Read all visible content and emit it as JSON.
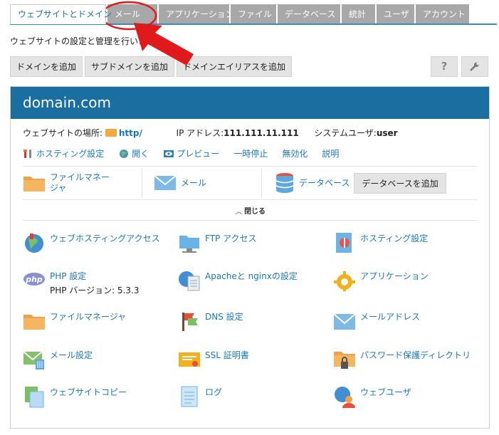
{
  "tabs": [
    {
      "label": "ウェブサイトとドメイン",
      "active": true
    },
    {
      "label": "メール"
    },
    {
      "label": "アプリケーション"
    },
    {
      "label": "ファイル"
    },
    {
      "label": "データベース"
    },
    {
      "label": "統計"
    },
    {
      "label": "ユーザ"
    },
    {
      "label": "アカウント"
    }
  ],
  "subtitle": "ウェブサイトの設定と管理を行います",
  "toolbar": {
    "add_domain": "ドメインを追加",
    "add_subdomain": "サブドメインを追加",
    "add_alias": "ドメインエイリアスを追加",
    "help": "?",
    "tools_icon": "wrench-icon"
  },
  "domain": {
    "name": "domain.com",
    "location_label": "ウェブサイトの場所:",
    "location_value": "http/",
    "ip_label": "IP アドレス:",
    "ip_value": "111.111.11.111",
    "sysuser_label": "システムユーザ:",
    "sysuser_value": "user"
  },
  "actions": [
    {
      "label": "ホスティング設定",
      "icon": "tools-icon"
    },
    {
      "label": "開く",
      "icon": "globe-open-icon"
    },
    {
      "label": "プレビュー",
      "icon": "eye-icon"
    },
    {
      "label": "一時停止"
    },
    {
      "label": "無効化"
    },
    {
      "label": "説明"
    }
  ],
  "quick": {
    "file_manager": "ファイルマネージャ",
    "file_manager_line1": "ファイルマネー",
    "file_manager_line2": "ジャ",
    "mail": "メール",
    "database": "データベース",
    "add_database": "データベースを追加"
  },
  "collapse_label": "閉じる",
  "tools": [
    {
      "label": "ウェブホスティングアクセス",
      "icon": "globe-user-icon"
    },
    {
      "label": "FTP アクセス",
      "icon": "ftp-folder-icon"
    },
    {
      "label": "ホスティング設定",
      "icon": "hosting-settings-icon"
    },
    {
      "label": "PHP 設定",
      "sub": "PHP バージョン: 5.3.3",
      "icon": "php-icon"
    },
    {
      "label": "Apacheと nginxの設定",
      "icon": "server-globe-icon"
    },
    {
      "label": "アプリケーション",
      "icon": "gear-icon"
    },
    {
      "label": "ファイルマネージャ",
      "icon": "folder-icon"
    },
    {
      "label": "DNS 設定",
      "icon": "flags-icon"
    },
    {
      "label": "メールアドレス",
      "icon": "envelope-icon"
    },
    {
      "label": "メール設定",
      "icon": "mail-settings-icon"
    },
    {
      "label": "SSL 証明書",
      "icon": "certificate-icon"
    },
    {
      "label": "パスワード保護ディレクトリ",
      "icon": "locked-folder-icon"
    },
    {
      "label": "ウェブサイトコピー",
      "icon": "copy-icon"
    },
    {
      "label": "ログ",
      "icon": "log-icon"
    },
    {
      "label": "ウェブユーザ",
      "icon": "web-user-icon"
    }
  ],
  "colors": {
    "accent": "#1a6fa0",
    "link": "#1a78b8",
    "tab_inactive": "#a8a8a8",
    "annotation": "#e0191b"
  }
}
